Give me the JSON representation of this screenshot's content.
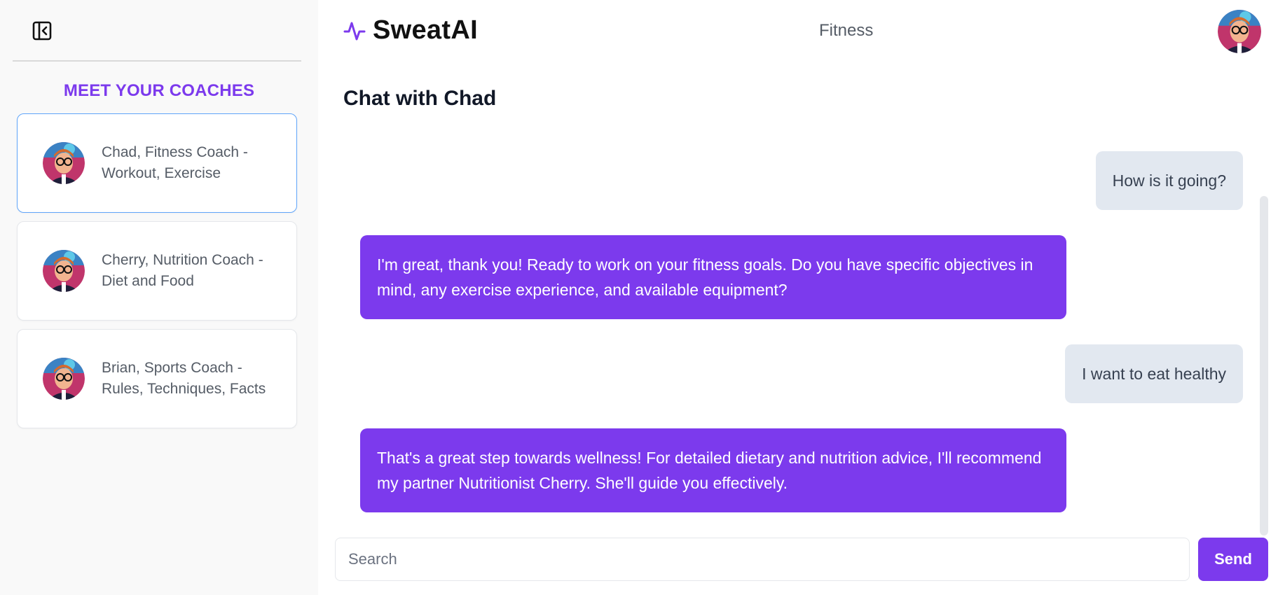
{
  "sidebar": {
    "heading": "MEET YOUR COACHES",
    "coaches": [
      {
        "label": "Chad, Fitness Coach - Workout, Exercise",
        "active": true
      },
      {
        "label": "Cherry, Nutrition Coach - Diet and Food",
        "active": false
      },
      {
        "label": "Brian, Sports Coach - Rules, Techniques, Facts",
        "active": false
      }
    ]
  },
  "header": {
    "brand": "SweatAI",
    "center_label": "Fitness"
  },
  "chat": {
    "title": "Chat with Chad",
    "messages": [
      {
        "role": "user",
        "text": "How is it going?"
      },
      {
        "role": "bot",
        "text": "I'm great, thank you! Ready to work on your fitness goals. Do you have specific objectives in mind, any exercise experience, and available equipment?"
      },
      {
        "role": "user",
        "text": "I want to eat healthy"
      },
      {
        "role": "bot",
        "text": "That's a great step towards wellness! For detailed dietary and nutrition advice, I'll recommend my partner Nutritionist Cherry. She'll guide you effectively."
      }
    ]
  },
  "composer": {
    "placeholder": "Search",
    "value": "",
    "send_label": "Send"
  },
  "colors": {
    "accent": "#7c3aed",
    "user_bubble": "#e2e8f0",
    "active_border": "#60a5fa"
  }
}
